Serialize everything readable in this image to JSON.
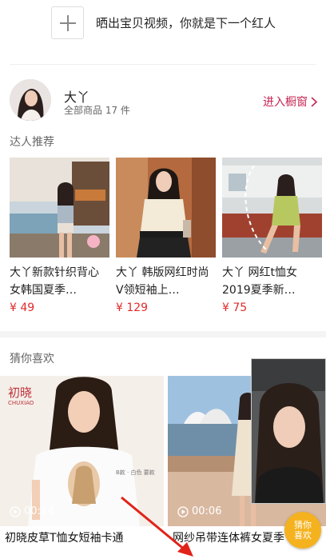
{
  "post_bar": {
    "text": "晒出宝贝视频，你就是下一个红人"
  },
  "shop": {
    "name": "大丫",
    "count_label": "全部商品 17 件",
    "enter_label": "进入橱窗"
  },
  "section_recommend": "达人推荐",
  "recommended": [
    {
      "title": "大丫新款针织背心女韩国夏季…",
      "price": "¥ 49"
    },
    {
      "title": "大丫 韩版网红时尚V领短袖上…",
      "price": "¥ 129"
    },
    {
      "title": "大丫 网红t恤女2019夏季新…",
      "price": "¥ 75"
    }
  ],
  "section_guess": "猜你喜欢",
  "feed": [
    {
      "duration": "00:44",
      "title": "初晓皮草T恤女短袖卡通",
      "brand": "初晓",
      "brand_sub": "CHUXIAO",
      "tag": "B款 · 白色 要款"
    },
    {
      "duration": "00:06",
      "title": "网纱吊带连体裤女夏季"
    }
  ],
  "guess_button": {
    "line1": "猜你",
    "line2": "喜欢"
  },
  "colors": {
    "accent": "#c62453",
    "price": "#e02a2a",
    "badge": "#f5b21f"
  }
}
